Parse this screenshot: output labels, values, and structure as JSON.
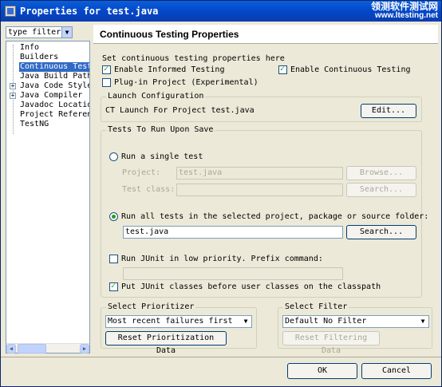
{
  "window": {
    "title": "Properties for test.java",
    "watermark_line1": "领测软件测试网",
    "watermark_line2": "www.ltesting.net"
  },
  "sidebar": {
    "filter": "type filter",
    "items": [
      {
        "label": "Info"
      },
      {
        "label": "Builders"
      },
      {
        "label": "Continuous Test"
      },
      {
        "label": "Java Build Path"
      },
      {
        "label": "Java Code Style"
      },
      {
        "label": "Java Compiler"
      },
      {
        "label": "Javadoc Location"
      },
      {
        "label": "Project Referen"
      },
      {
        "label": "TestNG"
      }
    ]
  },
  "page": {
    "title": "Continuous Testing Properties",
    "intro": "Set continuous testing properties here",
    "enable_informed": "Enable Informed Testing",
    "enable_continuous": "Enable Continuous Testing",
    "plugin_project": "Plug-in Project (Experimental)"
  },
  "launch": {
    "legend": "Launch Configuration",
    "text": "CT Launch For Project test.java",
    "edit_button": "Edit..."
  },
  "tests": {
    "legend": "Tests To Run Upon Save",
    "run_single": "Run a single test",
    "project_label": "Project:",
    "project_value": "test.java",
    "browse_button": "Browse...",
    "test_class_label": "Test class:",
    "search_button_disabled": "Search...",
    "run_all": "Run all tests in the selected project, package or source folder:",
    "run_all_value": "test.java",
    "search_button": "Search...",
    "low_priority": "Run JUnit in low priority.  Prefix command:",
    "put_junit": "Put JUnit classes before user classes on the classpath"
  },
  "prioritizer": {
    "legend": "Select Prioritizer",
    "selected": "Most recent failures first",
    "reset_button": "Reset Prioritization Data"
  },
  "filter": {
    "legend": "Select Filter",
    "selected": "Default No Filter",
    "reset_button": "Reset Filtering Data"
  },
  "footer": {
    "ok": "OK",
    "cancel": "Cancel"
  }
}
